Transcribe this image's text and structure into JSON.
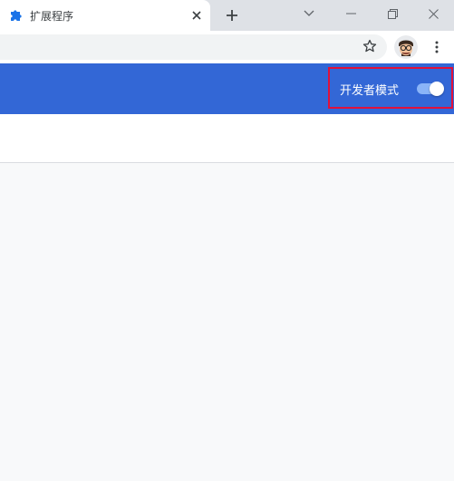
{
  "tab": {
    "title": "扩展程序",
    "favicon": "puzzle-piece-icon"
  },
  "window": {
    "controls": [
      "chevron-down-icon",
      "minimize-icon",
      "restore-icon",
      "close-icon"
    ]
  },
  "header": {
    "developer_mode_label": "开发者模式",
    "developer_mode_on": true,
    "accent_color": "#3367d6",
    "highlight_color": "#e0113b"
  }
}
